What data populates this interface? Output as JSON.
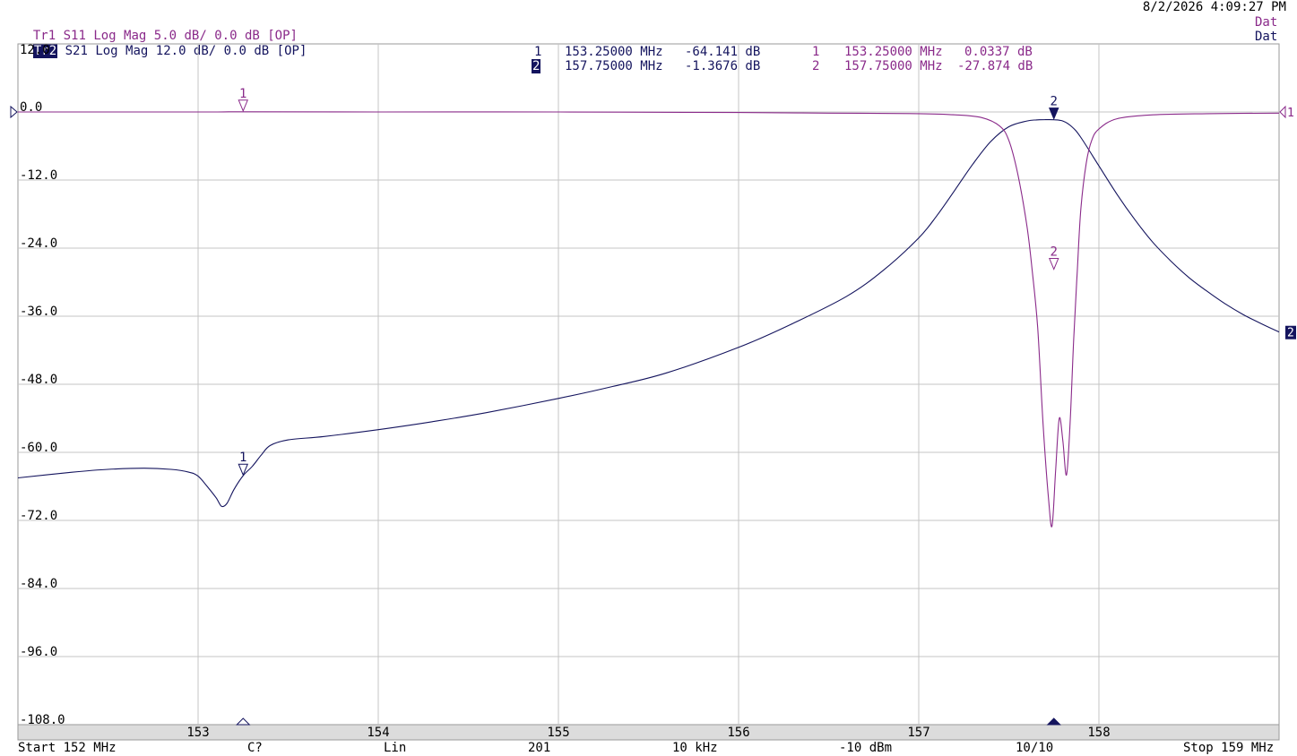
{
  "timestamp": "8/2/2026 4:09:27 PM",
  "traces": [
    {
      "id": "Tr1",
      "label": "Tr1",
      "param": "S11",
      "format": "Log Mag",
      "scale": "5.0 dB/",
      "ref": "0.0 dB",
      "status": "[OP]",
      "right_tag": "Dat",
      "color": "#8a2a8a",
      "selected": false
    },
    {
      "id": "Tr2",
      "label": "Tr2",
      "param": "S21",
      "format": "Log Mag",
      "scale": "12.0 dB/",
      "ref": "0.0 dB",
      "status": "[OP]",
      "right_tag": "Dat",
      "color": "#14145e",
      "selected": true
    }
  ],
  "marker_table": {
    "tr2": [
      {
        "num": "1",
        "freq": "153.25000 MHz",
        "value": "-64.141 dB"
      },
      {
        "num": "2",
        "freq": "157.75000 MHz",
        "value": "-1.3676 dB"
      }
    ],
    "tr1": [
      {
        "num": "1",
        "freq": "153.25000 MHz",
        "value": "0.0337 dB"
      },
      {
        "num": "2",
        "freq": "157.75000 MHz",
        "value": "-27.874 dB"
      }
    ]
  },
  "footer": {
    "start": "Start 152 MHz",
    "cal": "C?",
    "sweep": "Lin",
    "points": "201",
    "ifbw": "10 kHz",
    "power": "-10 dBm",
    "avg": "10/10",
    "stop": "Stop 159 MHz"
  },
  "chart_data": {
    "type": "line",
    "xlim": [
      152,
      159
    ],
    "ylim": [
      -108,
      12
    ],
    "x_ticks": [
      153,
      154,
      155,
      156,
      157,
      158
    ],
    "x_tick_labels": [
      "153",
      "154",
      "155",
      "156",
      "157",
      "158"
    ],
    "y_ticks": [
      12,
      0,
      -12,
      -24,
      -36,
      -48,
      -60,
      -72,
      -84,
      -96,
      -108
    ],
    "y_tick_labels": [
      "12.0",
      "0.0",
      "-12.0",
      "-24.0",
      "-36.0",
      "-48.0",
      "-60.0",
      "-72.0",
      "-84.0",
      "-96.0",
      "-108.0"
    ],
    "grid": true,
    "series": [
      {
        "trace": "Tr2",
        "color": "#14145e",
        "x": [
          152.0,
          152.3,
          152.5,
          152.7,
          152.85,
          152.95,
          153.0,
          153.05,
          153.1,
          153.13,
          153.16,
          153.2,
          153.25,
          153.3,
          153.35,
          153.4,
          153.5,
          153.7,
          154.0,
          154.3,
          154.6,
          155.0,
          155.3,
          155.6,
          156.0,
          156.3,
          156.6,
          156.8,
          157.0,
          157.1,
          157.2,
          157.3,
          157.4,
          157.5,
          157.6,
          157.65,
          157.7,
          157.75,
          157.8,
          157.85,
          157.9,
          158.0,
          158.1,
          158.2,
          158.3,
          158.4,
          158.5,
          158.6,
          158.7,
          158.8,
          158.9,
          159.0
        ],
        "y": [
          -64.5,
          -63.5,
          -63.0,
          -62.8,
          -63.0,
          -63.5,
          -64.2,
          -66.0,
          -68.0,
          -69.5,
          -69.0,
          -66.5,
          -64.1,
          -62.5,
          -60.5,
          -58.8,
          -57.8,
          -57.2,
          -56.0,
          -54.6,
          -53.0,
          -50.5,
          -48.4,
          -46.0,
          -41.5,
          -37.3,
          -32.5,
          -28.0,
          -22.2,
          -18.3,
          -13.8,
          -9.2,
          -5.2,
          -2.6,
          -1.6,
          -1.4,
          -1.35,
          -1.37,
          -1.6,
          -2.6,
          -4.5,
          -9.5,
          -14.5,
          -19.0,
          -23.0,
          -26.3,
          -29.2,
          -31.6,
          -33.8,
          -35.7,
          -37.3,
          -38.8
        ]
      },
      {
        "trace": "Tr1",
        "color": "#8a2a8a",
        "x": [
          152.0,
          153.0,
          153.25,
          154.0,
          155.0,
          156.0,
          156.5,
          157.0,
          157.2,
          157.35,
          157.45,
          157.5,
          157.55,
          157.6,
          157.63,
          157.66,
          157.69,
          157.72,
          157.74,
          157.76,
          157.78,
          157.8,
          157.82,
          157.84,
          157.86,
          157.88,
          157.9,
          157.93,
          157.96,
          158.0,
          158.1,
          158.3,
          158.6,
          159.0
        ],
        "y": [
          0.0,
          0.0,
          0.03,
          0.0,
          0.0,
          -0.1,
          -0.2,
          -0.3,
          -0.5,
          -1.0,
          -2.5,
          -5.0,
          -11.0,
          -20.0,
          -28.0,
          -38.0,
          -55.0,
          -68.0,
          -73.0,
          -63.0,
          -54.0,
          -58.0,
          -64.0,
          -55.0,
          -40.0,
          -28.0,
          -17.0,
          -9.0,
          -5.0,
          -3.0,
          -1.2,
          -0.5,
          -0.3,
          -0.2
        ]
      }
    ],
    "markers": [
      {
        "trace": "Tr2",
        "num": "1",
        "x": 153.25,
        "y": -64.141
      },
      {
        "trace": "Tr2",
        "num": "2",
        "x": 157.75,
        "y": -1.3676
      },
      {
        "trace": "Tr1",
        "num": "1",
        "x": 153.25,
        "y": 0.0337
      },
      {
        "trace": "Tr1",
        "num": "2",
        "x": 157.75,
        "y": -27.874
      }
    ],
    "ref_markers": [
      {
        "trace": "Tr1",
        "label": "1"
      },
      {
        "trace": "Tr2",
        "label": "2"
      }
    ]
  }
}
